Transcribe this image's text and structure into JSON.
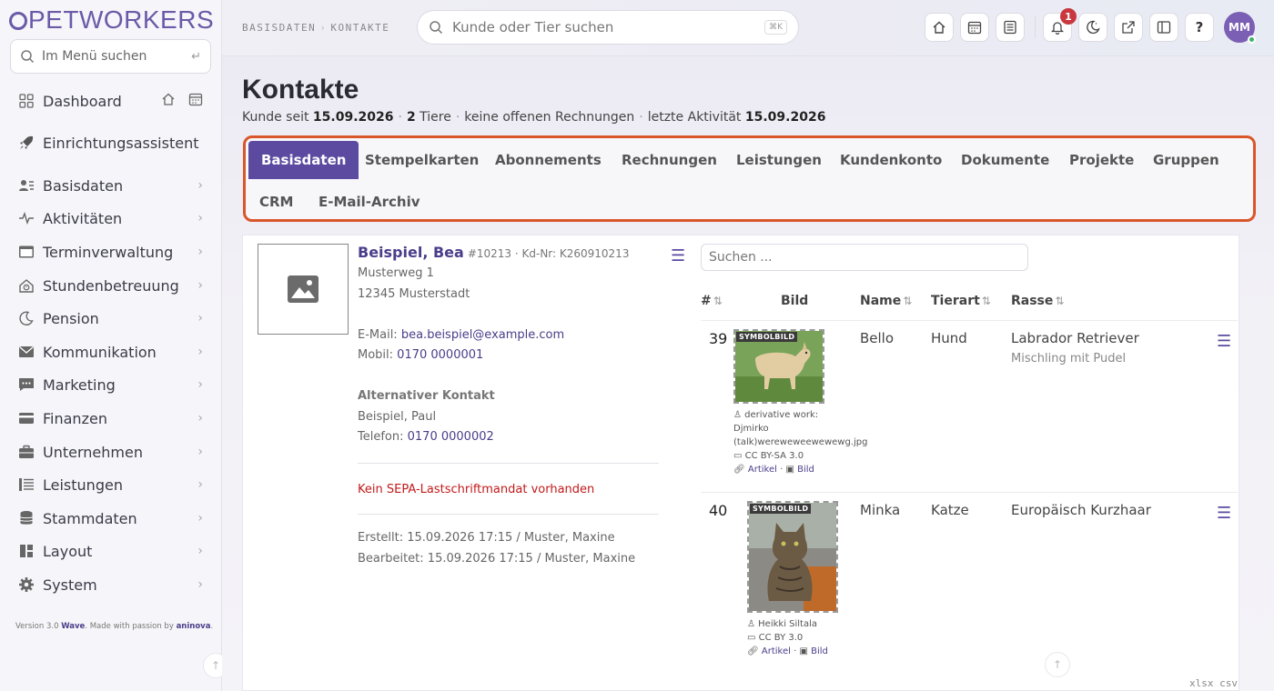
{
  "app": {
    "logo": "PETWORKERS",
    "version_prefix": "Version 3.0",
    "version_brand": "Wave",
    "version_mid": ". Made with passion by",
    "version_company": "aninova",
    "version_end": "."
  },
  "sidebar": {
    "search_placeholder": "Im Menü suchen",
    "enter_glyph": "↵",
    "items": [
      {
        "label": "Dashboard"
      },
      {
        "label": "Einrichtungsassistent"
      },
      {
        "label": "Basisdaten"
      },
      {
        "label": "Aktivitäten"
      },
      {
        "label": "Terminverwaltung"
      },
      {
        "label": "Stundenbetreuung"
      },
      {
        "label": "Pension"
      },
      {
        "label": "Kommunikation"
      },
      {
        "label": "Marketing"
      },
      {
        "label": "Finanzen"
      },
      {
        "label": "Unternehmen"
      },
      {
        "label": "Leistungen"
      },
      {
        "label": "Stammdaten"
      },
      {
        "label": "Layout"
      },
      {
        "label": "System"
      }
    ],
    "chevron": "›"
  },
  "header": {
    "crumb_1": "BASISDATEN",
    "crumb_sep": "›",
    "crumb_2": "KONTAKTE",
    "search_placeholder": "Kunde oder Tier suchen",
    "search_kbd": "⌘K",
    "notification_count": "1",
    "help_label": "?",
    "avatar_initials": "MM"
  },
  "page": {
    "title": "Kontakte",
    "sub_customer_since_label": "Kunde seit",
    "sub_customer_since": "15.09.2026",
    "sub_pets_count": "2",
    "sub_pets_label": "Tiere",
    "sub_invoices": "keine offenen Rechnungen",
    "sub_activity_label": "letzte Aktivität",
    "sub_activity": "15.09.2026",
    "dot": "·"
  },
  "tabs": [
    "Basisdaten",
    "Stempelkarten",
    "Abonnements",
    "Rechnungen",
    "Leistungen",
    "Kundenkonto",
    "Dokumente",
    "Projekte",
    "Gruppen",
    "CRM",
    "E-Mail-Archiv"
  ],
  "contact": {
    "name": "Beispiel, Bea",
    "meta": "#10213 · Kd-Nr: K260910213",
    "street": "Musterweg 1",
    "city": "12345 Musterstadt",
    "email_label": "E-Mail:",
    "email": "bea.beispiel@example.com",
    "mobile_label": "Mobil:",
    "mobile": "0170 0000001",
    "alt_heading": "Alternativer Kontakt",
    "alt_name": "Beispiel, Paul",
    "phone_label": "Telefon:",
    "phone": "0170 0000002",
    "sepa_warning": "Kein SEPA-Lastschriftmandat vorhanden",
    "created": "Erstellt: 15.09.2026 17:15 / Muster, Maxine",
    "edited": "Bearbeitet: 15.09.2026 17:15 / Muster, Maxine"
  },
  "pets_table": {
    "search_placeholder": "Suchen ...",
    "sort_glyph": "⇅",
    "columns": {
      "num": "#",
      "image": "Bild",
      "name": "Name",
      "species": "Tierart",
      "breed": "Rasse"
    },
    "rows": [
      {
        "num": "39",
        "name": "Bello",
        "species": "Hund",
        "breed": "Labrador Retriever",
        "breed_note": "Mischling mit Pudel",
        "image_tag": "SYMBOLBILD",
        "credit_author_1": "derivative work:",
        "credit_author_2": "Djmirko",
        "credit_author_3": "(talk)wereweweewewewg.jpg",
        "credit_license": "CC BY-SA 3.0",
        "credit_link_article": "Artikel",
        "credit_link_image": "Bild"
      },
      {
        "num": "40",
        "name": "Minka",
        "species": "Katze",
        "breed": "Europäisch Kurzhaar",
        "breed_note": "",
        "image_tag": "SYMBOLBILD",
        "credit_author_1": "Heikki Siltala",
        "credit_license": "CC BY 3.0",
        "credit_link_article": "Artikel",
        "credit_link_image": "Bild"
      }
    ],
    "export_xlsx": "xlsx",
    "export_csv": "csv"
  },
  "colors": {
    "accent": "#5b4aa0",
    "highlight": "#d9562b",
    "warning": "#c21a1a"
  }
}
